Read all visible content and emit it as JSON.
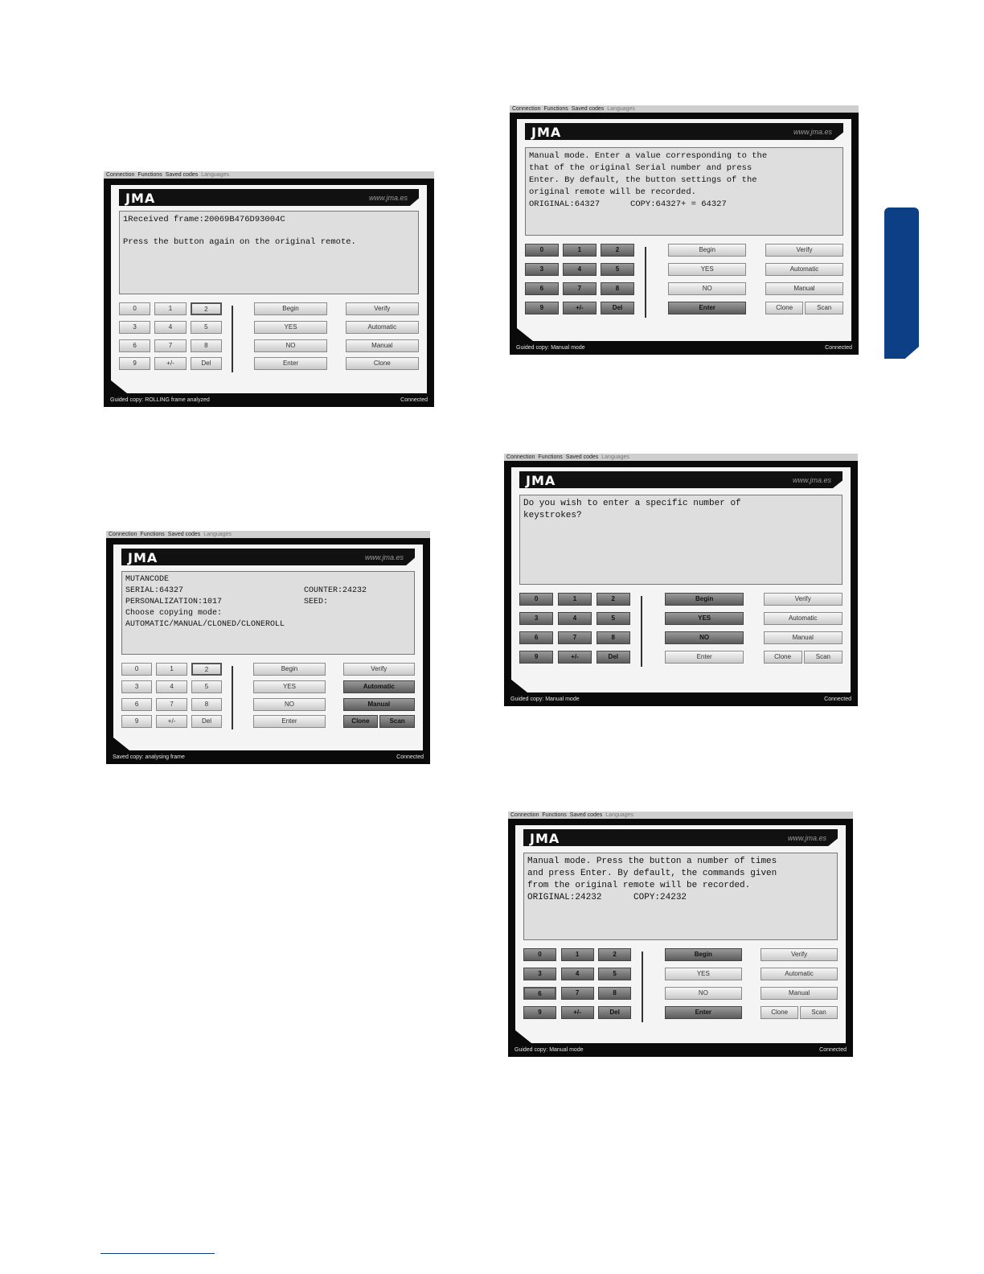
{
  "menu": [
    "Connection",
    "Functions",
    "Saved codes",
    "Languages"
  ],
  "logo": "JMA",
  "url": "www.jma.es",
  "status_right": "Connected",
  "screens": [
    {
      "lines": [
        "1Received frame:20069B476D93004C",
        "",
        "Press the button again on the original remote."
      ],
      "status": "Guided copy: ROLLING frame analyzed",
      "keys": [
        "0",
        "1",
        "2",
        "3",
        "4",
        "5",
        "6",
        "7",
        "8",
        "9",
        "+/-",
        "Del"
      ],
      "commands": [
        "Begin",
        "YES",
        "NO",
        "Enter"
      ],
      "modes": [
        "Verify",
        "Automatic",
        "Manual",
        "Clone"
      ]
    },
    {
      "lines": [
        "MUTANCODE",
        "SERIAL:64327                         COUNTER:24232",
        "PERSONALIZATION:1017                 SEED:",
        "Choose copying mode:",
        "AUTOMATIC/MANUAL/CLONED/CLONEROLL"
      ],
      "status": "Saved copy: analysing frame",
      "keys": [
        "0",
        "1",
        "2",
        "3",
        "4",
        "5",
        "6",
        "7",
        "8",
        "9",
        "+/-",
        "Del"
      ],
      "commands": [
        "Begin",
        "YES",
        "NO",
        "Enter"
      ],
      "modes": [
        "Verify",
        "Automatic",
        "Manual",
        "Clone",
        "Scan"
      ]
    },
    {
      "lines": [
        "Manual mode. Enter a value corresponding to the",
        "that of the original Serial number and press",
        "Enter. By default, the button settings of the",
        "original remote will be recorded.",
        "ORIGINAL:64327      COPY:64327+ = 64327"
      ],
      "status": "Guided copy: Manual mode",
      "keys": [
        "0",
        "1",
        "2",
        "3",
        "4",
        "5",
        "6",
        "7",
        "8",
        "9",
        "+/-",
        "Del"
      ],
      "commands": [
        "Begin",
        "YES",
        "NO",
        "Enter"
      ],
      "modes": [
        "Verify",
        "Automatic",
        "Manual",
        "Clone",
        "Scan"
      ]
    },
    {
      "lines": [
        "Do you wish to enter a specific number of",
        "keystrokes?"
      ],
      "status": "Guided copy: Manual mode",
      "keys": [
        "0",
        "1",
        "2",
        "3",
        "4",
        "5",
        "6",
        "7",
        "8",
        "9",
        "+/-",
        "Del"
      ],
      "commands": [
        "Begin",
        "YES",
        "NO",
        "Enter"
      ],
      "modes": [
        "Verify",
        "Automatic",
        "Manual",
        "Clone",
        "Scan"
      ]
    },
    {
      "lines": [
        "Manual mode. Press the button a number of times",
        "and press Enter. By default, the commands given",
        "from the original remote will be recorded.",
        "ORIGINAL:24232      COPY:24232"
      ],
      "status": "Guided copy: Manual mode",
      "keys": [
        "0",
        "1",
        "2",
        "3",
        "4",
        "5",
        "6",
        "7",
        "8",
        "9",
        "+/-",
        "Del"
      ],
      "commands": [
        "Begin",
        "YES",
        "NO",
        "Enter"
      ],
      "modes": [
        "Verify",
        "Automatic",
        "Manual",
        "Clone",
        "Scan"
      ]
    }
  ]
}
